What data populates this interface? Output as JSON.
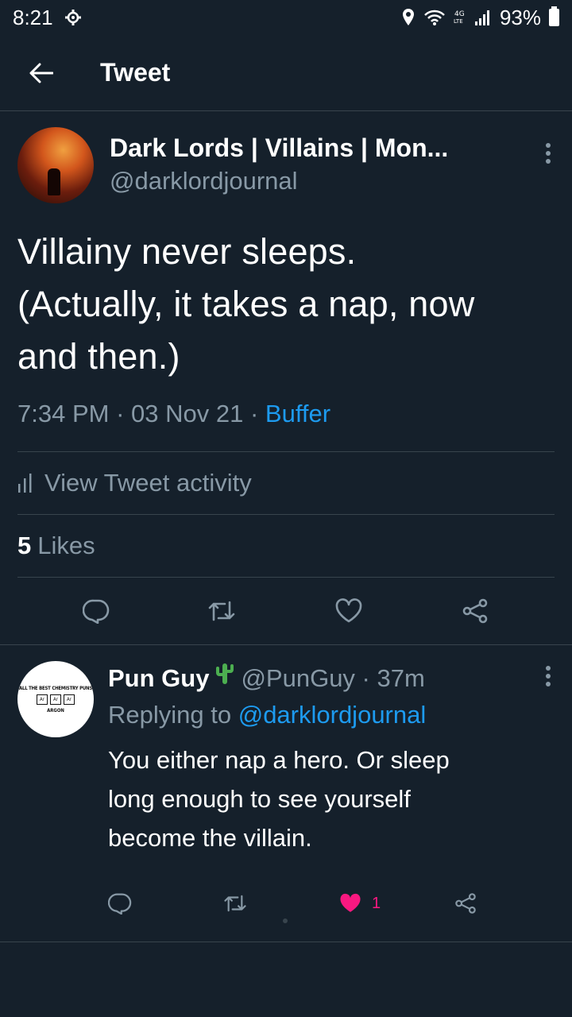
{
  "status_bar": {
    "time": "8:21",
    "battery": "93%"
  },
  "header": {
    "title": "Tweet"
  },
  "tweet": {
    "display_name": "Dark Lords | Villains | Mon...",
    "handle": "@darklordjournal",
    "text_lines": [
      "Villainy never sleeps.",
      "(Actually, it takes a nap, now",
      "and then.)"
    ],
    "time": "7:34 PM",
    "date": "03 Nov 21",
    "source": "Buffer",
    "activity_label": "View Tweet activity",
    "likes_count": "5",
    "likes_label": "Likes"
  },
  "reply": {
    "display_name": "Pun Guy",
    "handle": "@PunGuy",
    "age": "37m",
    "replying_prefix": "Replying to",
    "replying_to": "@darklordjournal",
    "text_lines": [
      "You either nap a hero. Or sleep",
      "long enough to see yourself",
      "become the villain."
    ],
    "like_count": "1",
    "avatar_top": "ALL THE BEST CHEMISTRY PUNS",
    "avatar_box": "Ar",
    "avatar_bottom": "ARGON"
  },
  "colors": {
    "background": "#15202b",
    "accent": "#1d9bf0",
    "like": "#f91880",
    "muted": "#8899a6"
  },
  "icons": [
    "settings-icon",
    "location-icon",
    "wifi-icon",
    "signal-icon",
    "battery-icon",
    "back-arrow-icon",
    "more-vertical-icon",
    "bar-chart-icon",
    "reply-icon",
    "retweet-icon",
    "heart-icon",
    "share-icon",
    "cactus-icon"
  ]
}
